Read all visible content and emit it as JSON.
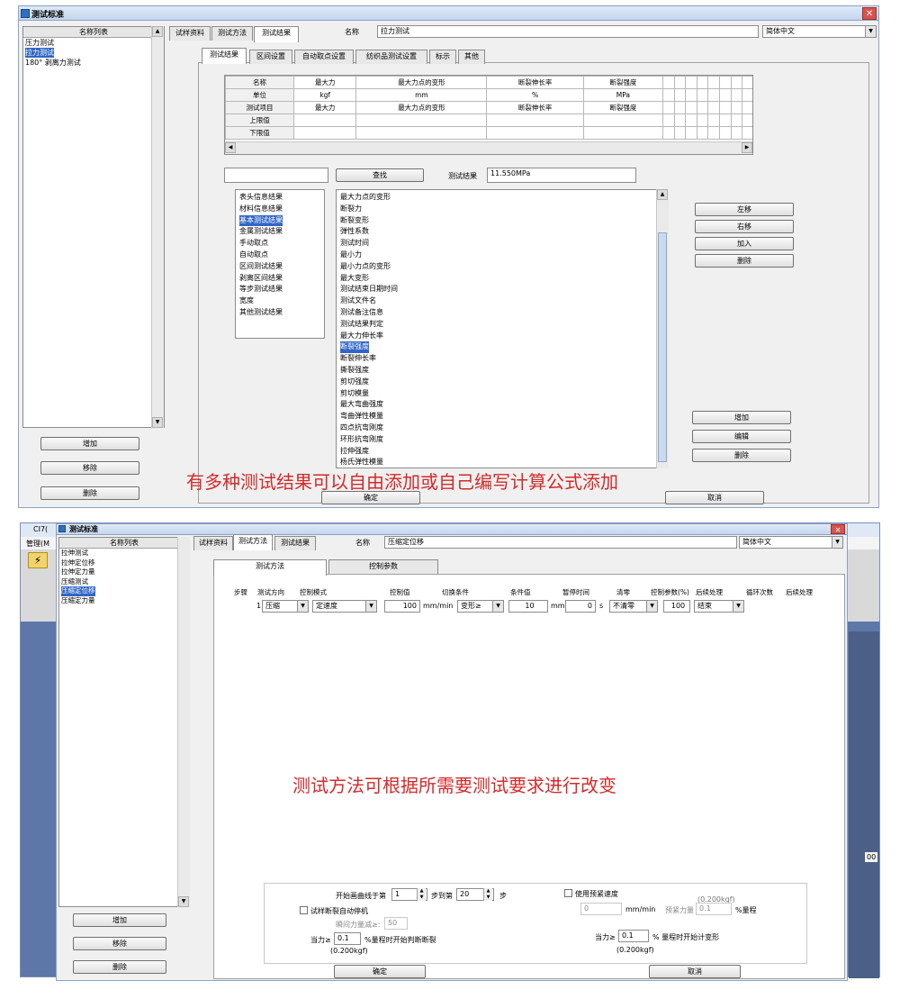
{
  "top": {
    "title": "测试标准",
    "close": "✕",
    "list_header": "名称列表",
    "list_items": [
      "压力测试",
      "拉力测试",
      "180° 剥离力测试"
    ],
    "selected_index": 1,
    "left_buttons": {
      "add": "增加",
      "move": "移除",
      "delete": "删除"
    },
    "tabs": [
      "试样资料",
      "测试方法",
      "测试结果"
    ],
    "name_label": "名称",
    "name_value": "拉力测试",
    "language": "简体中文",
    "sub_tabs": [
      "测试结果",
      "区间设置",
      "自动取点设置",
      "纺织品测试设置",
      "标示",
      "其他"
    ],
    "grid_rows": [
      [
        "名称",
        "最大力",
        "最大力点的变形",
        "断裂伸长率",
        "断裂强度"
      ],
      [
        "单位",
        "kgf",
        "mm",
        "%",
        "MPa"
      ],
      [
        "测试项目",
        "最大力",
        "最大力点的变形",
        "断裂伸长率",
        "断裂强度"
      ],
      [
        "上限值",
        "",
        "",
        "",
        ""
      ],
      [
        "下限值",
        "",
        "",
        "",
        ""
      ]
    ],
    "find_button": "查找",
    "result_label": "测试结果",
    "result_value": "11.550MPa",
    "categories": [
      "表头信息结果",
      "材料信息结果",
      "基本测试结果",
      "金属测试结果",
      "手动取点",
      "自动取点",
      "区间测试结果",
      "剥离区间结果",
      "等步测试结果",
      "宽度",
      "其他测试结果"
    ],
    "category_selected": 2,
    "results": [
      "最大力点的变形",
      "断裂力",
      "断裂变形",
      "弹性系数",
      "测试时间",
      "最小力",
      "最小力点的变形",
      "最大变形",
      "测试结束日期时间",
      "测试文件名",
      "测试备注信息",
      "测试结果判定",
      "最大力伸长率",
      "断裂强度",
      "断裂伸长率",
      "撕裂强度",
      "剪切强度",
      "剪切模量",
      "最大弯曲强度",
      "弯曲弹性模量",
      "四点抗弯刚度",
      "环形抗弯刚度",
      "拉伸强度",
      "杨氏弹性模量"
    ],
    "result_selected": 13,
    "side_buttons": {
      "left": "左移",
      "right": "右移",
      "join": "加入",
      "remove": "删除"
    },
    "lower_buttons": {
      "add": "增加",
      "edit": "编辑",
      "delete": "删除"
    },
    "ok": "确定",
    "cancel": "取消",
    "caption": "有多种测试结果可以自由添加或自己编写计算公式添加"
  },
  "bottom": {
    "bg_title": "CI7(",
    "bg_menu": "管理(M",
    "bg_icon": "⚡",
    "bg_value": "00",
    "title": "测试标准",
    "close": "✕",
    "list_header": "名称列表",
    "list_items": [
      "拉伸测试",
      "拉伸定位移",
      "拉伸定力量",
      "压缩测试",
      "压缩定位移",
      "压缩定力量"
    ],
    "selected_index": 4,
    "left_buttons": {
      "add": "增加",
      "move": "移除",
      "delete": "删除"
    },
    "tabs": [
      "试样资料",
      "测试方法",
      "测试结果"
    ],
    "name_label": "名称",
    "name_value": "压缩定位移",
    "language": "简体中文",
    "sub_tabs": [
      "测试方法",
      "控制参数"
    ],
    "columns": [
      "步骤",
      "测试方向",
      "控制模式",
      "控制值",
      "切换条件",
      "条件值",
      "暂停时间",
      "清零",
      "控制参数(%)",
      "后续处理",
      "循环次数",
      "后续处理"
    ],
    "row": {
      "step": "1",
      "direction": "压缩",
      "mode": "定速度",
      "value": "100",
      "unit": "mm/min",
      "cond": "变形≥",
      "cond_value": "10",
      "cond_unit": "mm",
      "pause": "0",
      "pause_unit": "s",
      "zero": "不清零",
      "param": "100",
      "after": "结束"
    },
    "caption": "测试方法可根据所需要测试要求进行改变",
    "opts": {
      "start_label": "开始画曲线于第",
      "start_value": "1",
      "to_label": "步到第",
      "to_value": "20",
      "step_label": "步",
      "preload_label": "使用预紧速度",
      "preload_kgf": "(0.200kgf)",
      "preload_speed": "0",
      "preload_unit": "mm/min",
      "preload_force_label": "预紧力量",
      "preload_force": "0.1",
      "preload_pct": "%量程",
      "auto_stop": "试样断裂自动停机",
      "drop_label": "瞬间力量减≥:",
      "drop_value": "50",
      "when_label": "当力≥",
      "when_value": "0.1",
      "when_text": "%量程时开始判断断裂",
      "when_kgf": "(0.200kgf)",
      "strain_label": "当力≥",
      "strain_value": "0.1",
      "strain_text": "% 量程时开始计变形",
      "strain_kgf": "(0.200kgf)"
    },
    "ok": "确定",
    "cancel": "取消"
  }
}
